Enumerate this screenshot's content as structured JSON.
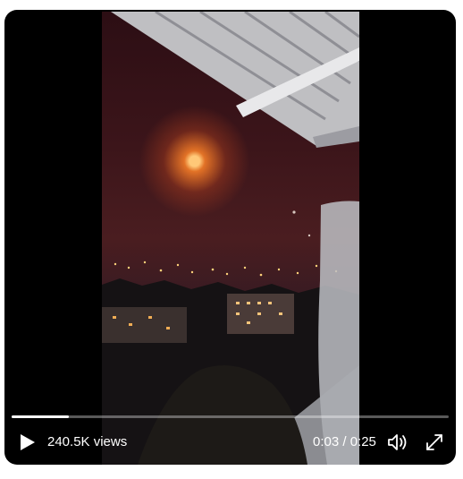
{
  "player": {
    "views_label": "240.5K views",
    "time_label": "0:03 / 0:25",
    "progress_fraction": 0.13
  },
  "icons": {
    "play": "play-icon",
    "volume": "volume-icon",
    "fullscreen": "fullscreen-icon"
  },
  "colors": {
    "player_background": "#000000",
    "overlay_text": "#ffffff",
    "page_background": "#ffffff"
  }
}
